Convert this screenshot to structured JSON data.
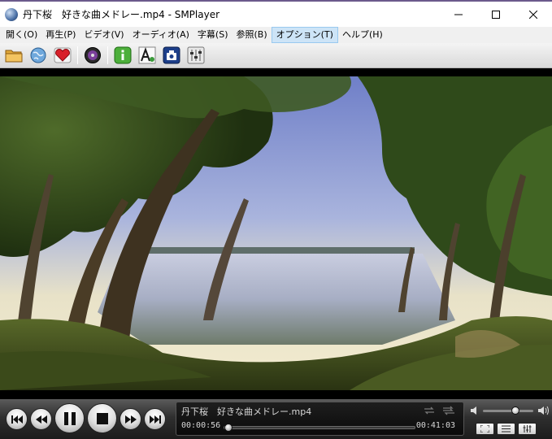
{
  "window": {
    "title": "丹下桜　好きな曲メドレー.mp4 - SMPlayer",
    "app_icon": "smplayer-icon",
    "buttons": [
      "minimize-icon",
      "maximize-icon",
      "close-icon"
    ]
  },
  "menu": {
    "items": [
      {
        "label": "開く(O)"
      },
      {
        "label": "再生(P)"
      },
      {
        "label": "ビデオ(V)"
      },
      {
        "label": "オーディオ(A)"
      },
      {
        "label": "字幕(S)"
      },
      {
        "label": "参照(B)"
      },
      {
        "label": "オプション(T)",
        "active": true
      },
      {
        "label": "ヘルプ(H)"
      }
    ]
  },
  "toolbar": {
    "icons": [
      "open-folder-icon",
      "open-url-icon",
      "favorites-heart-icon",
      "disc-icon",
      "info-icon",
      "font-subtitle-icon",
      "screenshot-camera-icon",
      "equalizer-icon"
    ]
  },
  "player": {
    "now_playing": "丹下桜　好きな曲メドレー.mp4",
    "elapsed": "00:00:56",
    "total": "00:41:03",
    "progress": 0.0227,
    "volume": 0.65
  },
  "colors": {
    "titlebar_accent": "#6b5a8c",
    "menu_active_bg": "#cde4f7",
    "control_bg": "#2f2f2f"
  }
}
